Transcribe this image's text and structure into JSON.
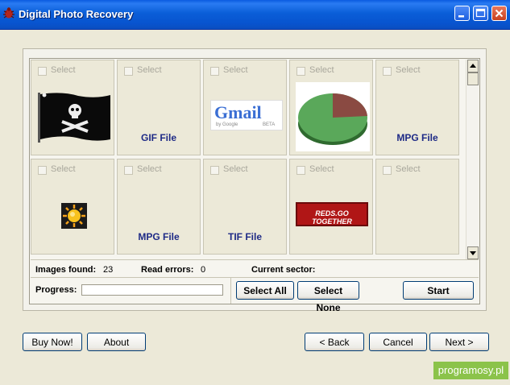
{
  "window": {
    "title": "Digital Photo Recovery"
  },
  "cells": [
    {
      "select": "Select",
      "label": "",
      "thumb": "pirate-flag"
    },
    {
      "select": "Select",
      "label": "GIF File",
      "thumb": ""
    },
    {
      "select": "Select",
      "label": "",
      "thumb": "gmail-logo"
    },
    {
      "select": "Select",
      "label": "",
      "thumb": "pie-chart"
    },
    {
      "select": "Select",
      "label": "MPG File",
      "thumb": ""
    },
    {
      "select": "Select",
      "label": "",
      "thumb": "sun-icon"
    },
    {
      "select": "Select",
      "label": "MPG File",
      "thumb": ""
    },
    {
      "select": "Select",
      "label": "TIF File",
      "thumb": ""
    },
    {
      "select": "Select",
      "label": "",
      "thumb": "banner"
    },
    {
      "select": "Select",
      "label": "",
      "thumb": ""
    }
  ],
  "thumbnails": {
    "gmail": {
      "logo": "Gmail",
      "tagline": "by Google",
      "beta": "BETA"
    },
    "banner": {
      "text": "REDS.GO TOGETHER"
    }
  },
  "status": {
    "images_found_label": "Images found:",
    "images_found_value": "23",
    "read_errors_label": "Read errors:",
    "read_errors_value": "0",
    "current_sector_label": "Current sector:",
    "current_sector_value": ""
  },
  "progress": {
    "label": "Progress:",
    "fraction": 0
  },
  "buttons": {
    "select_all": "Select All",
    "select_none": "Select None",
    "start": "Start",
    "buy_now": "Buy Now!",
    "about": "About",
    "back": "< Back",
    "cancel": "Cancel",
    "next": "Next >"
  },
  "watermark": "programosy.pl",
  "colors": {
    "titlebar": "#0a5ed8",
    "accent_label": "#1e2a86",
    "watermark_bg": "#8bc34a"
  }
}
